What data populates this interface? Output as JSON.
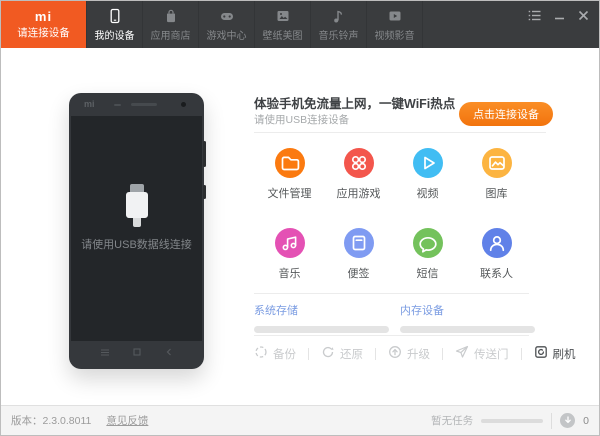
{
  "brand": {
    "logo": "mi",
    "status": "请连接设备",
    "accent_color": "#f15a22"
  },
  "tabs": [
    {
      "label": "我的设备",
      "icon": "phone-icon",
      "active": true
    },
    {
      "label": "应用商店",
      "icon": "store-bag-icon",
      "active": false
    },
    {
      "label": "游戏中心",
      "icon": "gamepad-icon",
      "active": false
    },
    {
      "label": "壁纸美图",
      "icon": "wallpaper-icon",
      "active": false
    },
    {
      "label": "音乐铃声",
      "icon": "music-note-icon",
      "active": false
    },
    {
      "label": "视频影音",
      "icon": "video-icon",
      "active": false
    }
  ],
  "phone": {
    "logo": "mi",
    "usb_hint": "请使用USB数据线连接"
  },
  "main": {
    "headline": "体验手机免流量上网，一键WiFi热点",
    "subtext": "请使用USB连接设备",
    "connect_button": "点击连接设备",
    "connect_button_color": "#f5780f",
    "shortcuts": [
      {
        "label": "文件管理",
        "icon": "folder-icon",
        "color": "#fb7a10"
      },
      {
        "label": "应用游戏",
        "icon": "apps-grid-icon",
        "color": "#f3564c"
      },
      {
        "label": "视频",
        "icon": "play-icon",
        "color": "#41bdf3"
      },
      {
        "label": "图库",
        "icon": "gallery-icon",
        "color": "#fcb441"
      },
      {
        "label": "音乐",
        "icon": "music-notes-icon",
        "color": "#e451b4"
      },
      {
        "label": "便签",
        "icon": "notes-icon",
        "color": "#7f9bf2"
      },
      {
        "label": "短信",
        "icon": "sms-bubble-icon",
        "color": "#74c25c"
      },
      {
        "label": "联系人",
        "icon": "contact-icon",
        "color": "#6081e8"
      }
    ],
    "storage": [
      {
        "label": "系统存储",
        "percent": 0
      },
      {
        "label": "内存设备",
        "percent": 0
      }
    ],
    "storage_label_color": "#7b9ce2",
    "tools": [
      {
        "label": "备份",
        "icon": "backup-icon",
        "enabled": false
      },
      {
        "label": "还原",
        "icon": "restore-icon",
        "enabled": false
      },
      {
        "label": "升级",
        "icon": "upgrade-icon",
        "enabled": false
      },
      {
        "label": "传送门",
        "icon": "portal-icon",
        "enabled": false
      },
      {
        "label": "刷机",
        "icon": "flash-icon",
        "enabled": true
      }
    ]
  },
  "statusbar": {
    "version_label": "版本：",
    "version": "2.3.0.8011",
    "feedback_link": "意见反馈",
    "no_task_text": "暂无任务",
    "task_count": "0"
  }
}
